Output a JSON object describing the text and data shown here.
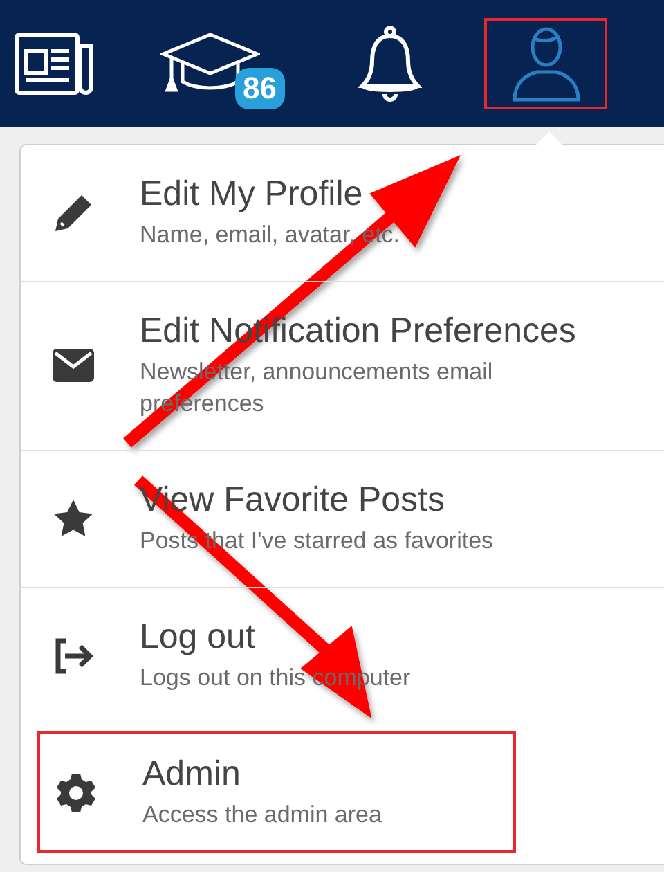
{
  "nav": [
    {
      "kind": "news",
      "highlighted": false
    },
    {
      "kind": "courses",
      "badge": "86",
      "highlighted": false
    },
    {
      "kind": "notifications",
      "highlighted": false
    },
    {
      "kind": "account",
      "highlighted": true
    }
  ],
  "menu": [
    {
      "title": "Edit My Profile",
      "subtitle": "Name, email, avatar, etc.",
      "highlighted": false
    },
    {
      "title": "Edit Notification Preferences",
      "subtitle": "Newsletter, announcements email preferences",
      "highlighted": false
    },
    {
      "title": "View Favorite Posts",
      "subtitle": "Posts that I've starred as favorites",
      "highlighted": false
    },
    {
      "title": "Log out",
      "subtitle": "Logs out on this computer",
      "highlighted": false
    },
    {
      "title": "Admin",
      "subtitle": "Access the admin area",
      "highlighted": true
    }
  ]
}
